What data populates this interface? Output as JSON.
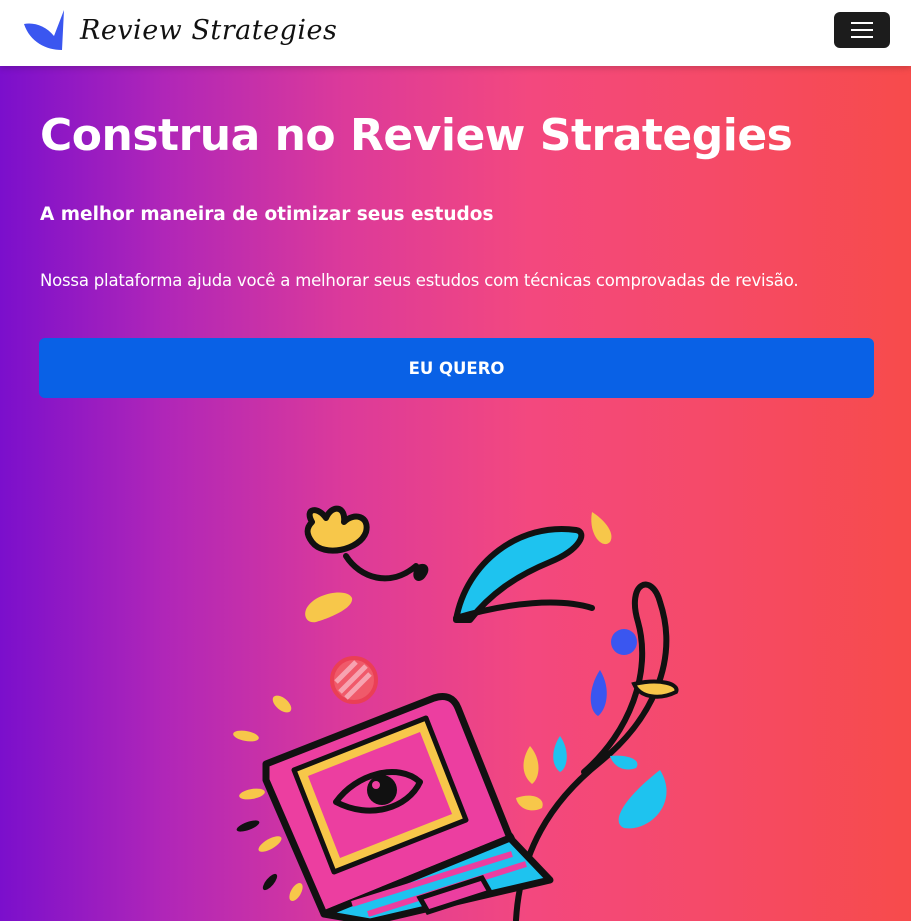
{
  "navbar": {
    "brand_name": "Review Strategies",
    "logo_icon": "bird-wing-logo",
    "menu_icon": "hamburger-menu-icon",
    "brand_color": "#3a56f0"
  },
  "hero": {
    "title": "Construa no Review Strategies",
    "subtitle": "A melhor maneira de otimizar seus estudos",
    "text": "Nossa plataforma ajuda você a melhorar seus estudos com técnicas comprovadas de revisão.",
    "cta_label": "EU QUERO",
    "gradient_start": "#7b0fcc",
    "gradient_end": "#f74b4b",
    "cta_color": "#0961e6",
    "illustration": "laptop-with-eye-and-plants-illustration"
  }
}
